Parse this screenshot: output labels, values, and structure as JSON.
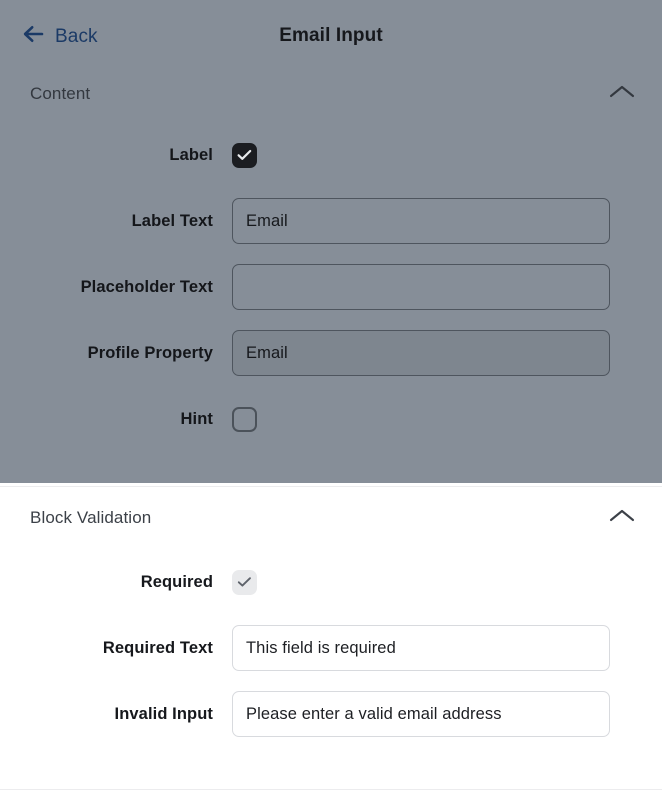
{
  "header": {
    "back_label": "Back",
    "back_icon": "arrow-left-icon",
    "title": "Email Input"
  },
  "colors": {
    "overlay_scrim": "#868e98",
    "back_link": "#1b3a66",
    "panel_background": "#ffffff",
    "checkbox_checked": "#1b1d21",
    "checkbox_muted": "#e9eaec",
    "input_border_light": "#d8dade",
    "input_border_dim": "#4e555e"
  },
  "content_section": {
    "title": "Content",
    "collapse_icon": "chevron-up-icon",
    "expanded": true,
    "rows": [
      {
        "label": "Label",
        "type": "checkbox",
        "state": "checked"
      },
      {
        "label": "Label Text",
        "type": "text",
        "value": "Email",
        "placeholder": ""
      },
      {
        "label": "Placeholder Text",
        "type": "text",
        "value": "",
        "placeholder": ""
      },
      {
        "label": "Profile Property",
        "type": "text",
        "value": "Email",
        "placeholder": "",
        "readonly": true
      },
      {
        "label": "Hint",
        "type": "checkbox",
        "state": "unchecked"
      }
    ]
  },
  "validation_section": {
    "title": "Block Validation",
    "collapse_icon": "chevron-up-icon",
    "expanded": true,
    "rows": [
      {
        "label": "Required",
        "type": "checkbox",
        "state": "checked-muted"
      },
      {
        "label": "Required Text",
        "type": "text",
        "value": "This field is required",
        "placeholder": ""
      },
      {
        "label": "Invalid Input",
        "type": "text",
        "value": "Please enter a valid email address",
        "placeholder": ""
      }
    ]
  }
}
